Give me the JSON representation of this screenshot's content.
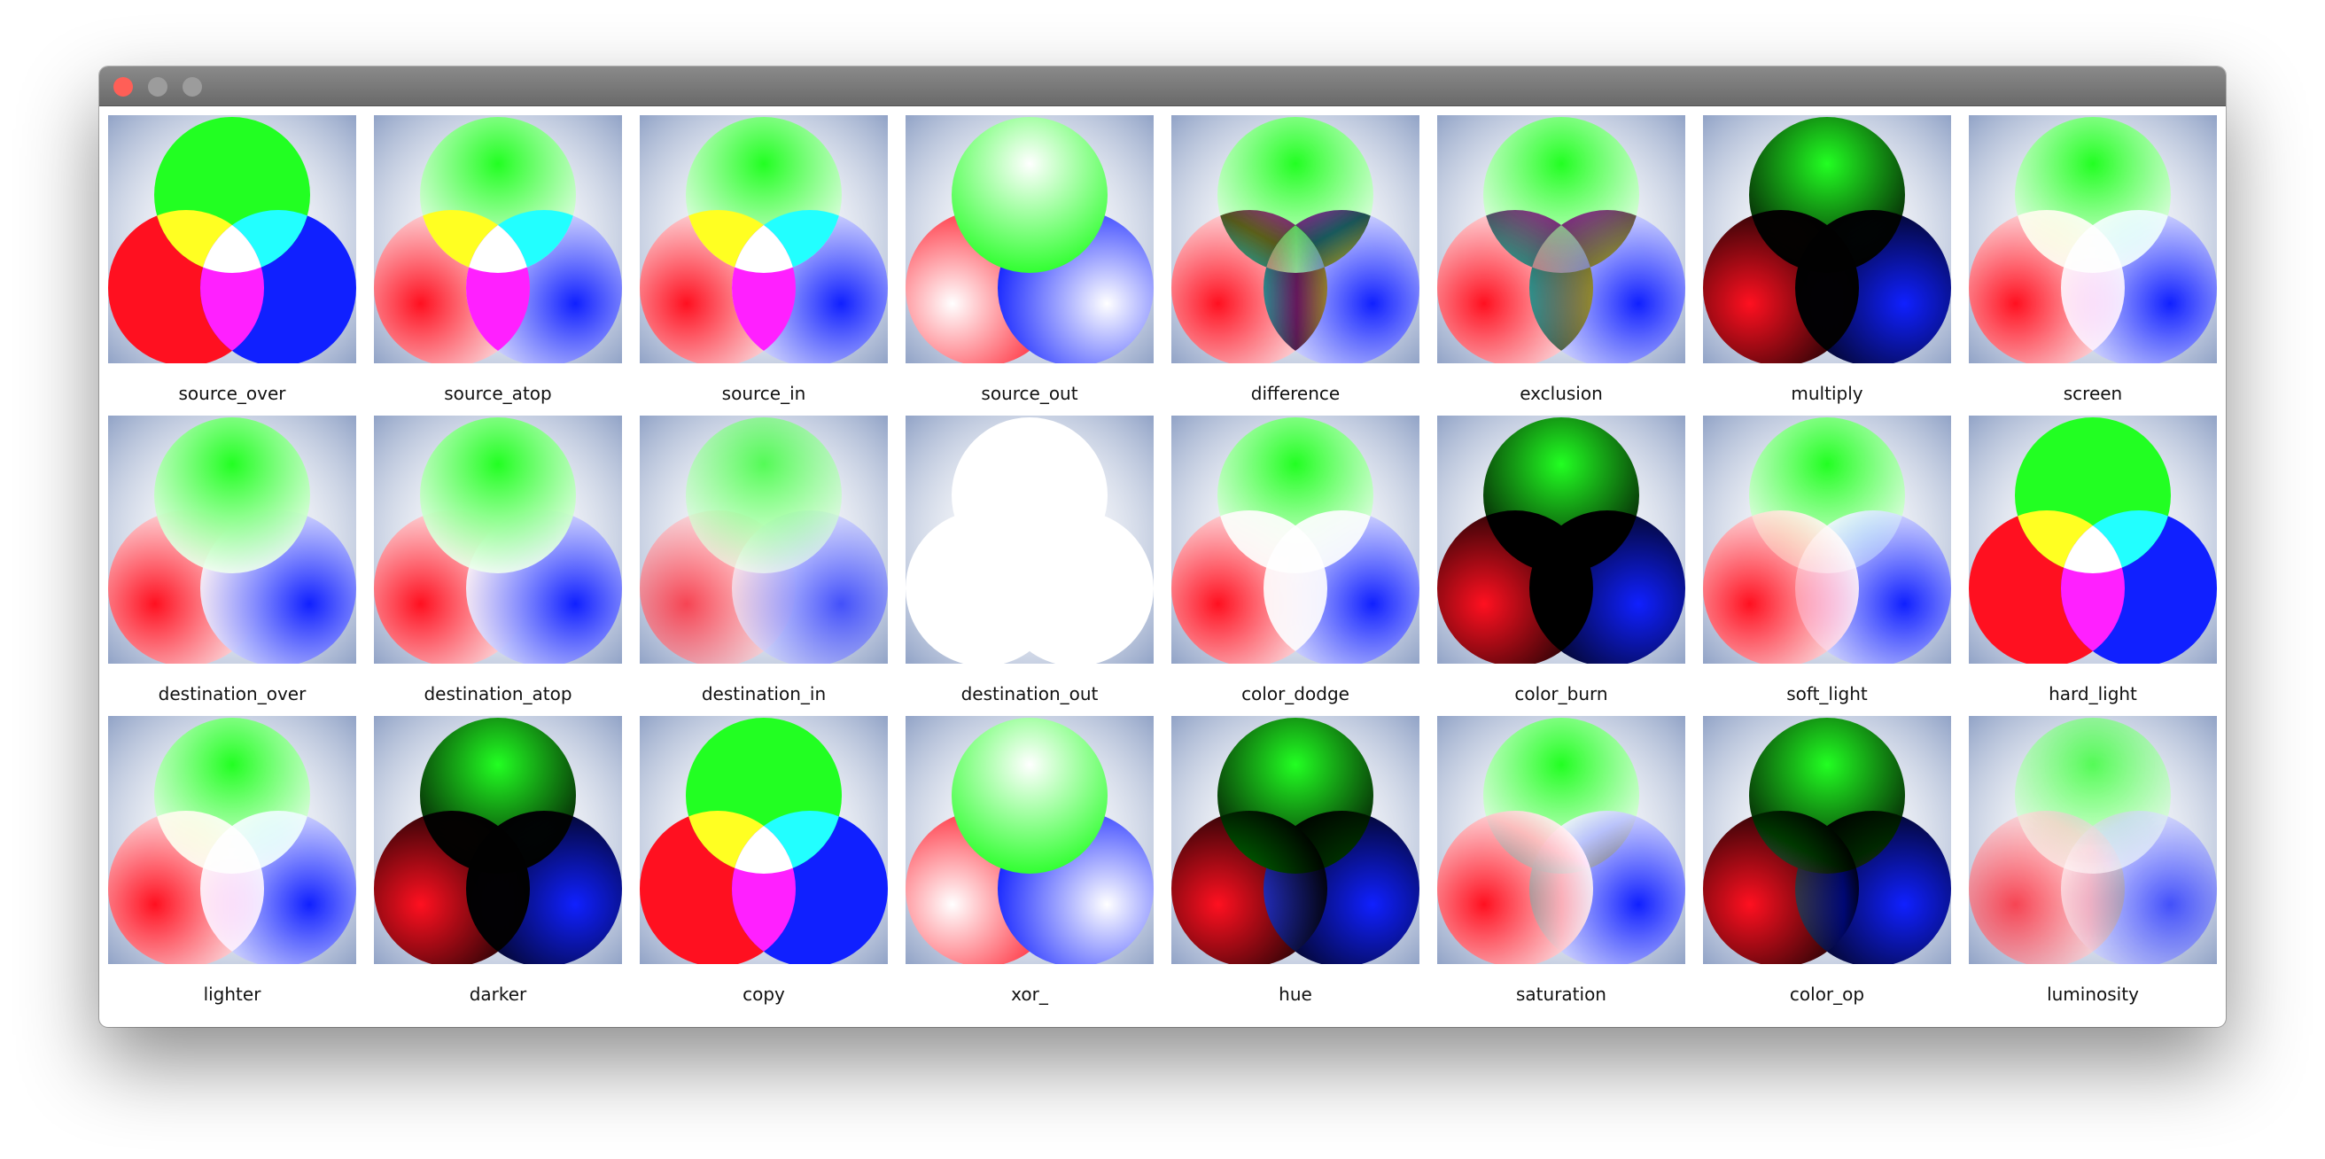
{
  "window": {
    "controls": {
      "close_color": "#ff5f57",
      "minimize_color": "#9c9c9c",
      "zoom_color": "#9c9c9c"
    }
  },
  "modes": [
    {
      "label": "source_over",
      "blend": "normal",
      "fade": false,
      "tone": "solid"
    },
    {
      "label": "source_atop",
      "blend": "normal",
      "fade": true,
      "tone": "solid"
    },
    {
      "label": "source_in",
      "blend": "normal",
      "fade": true,
      "tone": "solid"
    },
    {
      "label": "source_out",
      "blend": "normal",
      "fade": true,
      "tone": "pale"
    },
    {
      "label": "difference",
      "blend": "difference",
      "fade": true,
      "tone": "solid"
    },
    {
      "label": "exclusion",
      "blend": "exclusion",
      "fade": true,
      "tone": "solid"
    },
    {
      "label": "multiply",
      "blend": "multiply",
      "fade": true,
      "tone": "dark"
    },
    {
      "label": "screen",
      "blend": "screen",
      "fade": true,
      "tone": "solid"
    },
    {
      "label": "destination_over",
      "blend": "normal",
      "fade": true,
      "tone": "soft"
    },
    {
      "label": "destination_atop",
      "blend": "normal",
      "fade": true,
      "tone": "soft"
    },
    {
      "label": "destination_in",
      "blend": "normal",
      "fade": true,
      "tone": "muted"
    },
    {
      "label": "destination_out",
      "blend": "normal",
      "fade": true,
      "tone": "white"
    },
    {
      "label": "color_dodge",
      "blend": "color-dodge",
      "fade": true,
      "tone": "solid"
    },
    {
      "label": "color_burn",
      "blend": "color-burn",
      "fade": true,
      "tone": "dark"
    },
    {
      "label": "soft_light",
      "blend": "soft-light",
      "fade": true,
      "tone": "soft"
    },
    {
      "label": "hard_light",
      "blend": "normal",
      "fade": false,
      "tone": "solid"
    },
    {
      "label": "lighter",
      "blend": "screen",
      "fade": true,
      "tone": "solid"
    },
    {
      "label": "darker",
      "blend": "multiply",
      "fade": true,
      "tone": "dark"
    },
    {
      "label": "copy",
      "blend": "normal",
      "fade": false,
      "tone": "solid"
    },
    {
      "label": "xor_",
      "blend": "normal",
      "fade": true,
      "tone": "pale"
    },
    {
      "label": "hue",
      "blend": "hue",
      "fade": true,
      "tone": "dark"
    },
    {
      "label": "saturation",
      "blend": "saturation",
      "fade": true,
      "tone": "soft"
    },
    {
      "label": "color_op",
      "blend": "color",
      "fade": true,
      "tone": "dark"
    },
    {
      "label": "luminosity",
      "blend": "luminosity",
      "fade": true,
      "tone": "muted"
    }
  ],
  "colors": {
    "green": "#22ff22",
    "red": "#ff1020",
    "blue": "#1020ff",
    "yellow": "#ffff22",
    "cyan": "#22ffff",
    "magenta": "#ff20ff",
    "backdrop": "#3a5a9a"
  }
}
